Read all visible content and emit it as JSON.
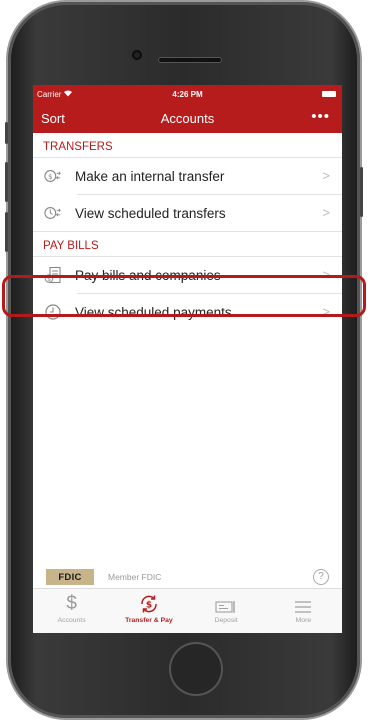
{
  "status_bar": {
    "carrier": "Carrier ",
    "time": "4:26 PM"
  },
  "nav": {
    "sort_label": "Sort",
    "title": "Accounts",
    "more_label": "•••"
  },
  "sections": [
    {
      "header": "TRANSFERS",
      "items": [
        {
          "label": "Make an internal transfer",
          "icon": "dollar-transfer-icon"
        },
        {
          "label": "View scheduled transfers",
          "icon": "clock-transfer-icon"
        }
      ]
    },
    {
      "header": "PAY BILLS",
      "items": [
        {
          "label": "Pay bills and companies",
          "icon": "bill-icon"
        },
        {
          "label": "View scheduled payments",
          "icon": "clock-icon"
        }
      ]
    }
  ],
  "chevron": ">",
  "footer": {
    "fdic_badge": "FDIC",
    "fdic_text": "Member FDIC",
    "help": "?"
  },
  "tabs": [
    {
      "label": "Accounts",
      "icon": "dollar-icon",
      "active": false
    },
    {
      "label": "Transfer & Pay",
      "icon": "transfer-pay-icon",
      "active": true
    },
    {
      "label": "Deposit",
      "icon": "check-deposit-icon",
      "active": false
    },
    {
      "label": "More",
      "icon": "menu-icon",
      "active": false
    }
  ],
  "colors": {
    "brand": "#b71c1c",
    "highlight": "#b51a1a"
  }
}
